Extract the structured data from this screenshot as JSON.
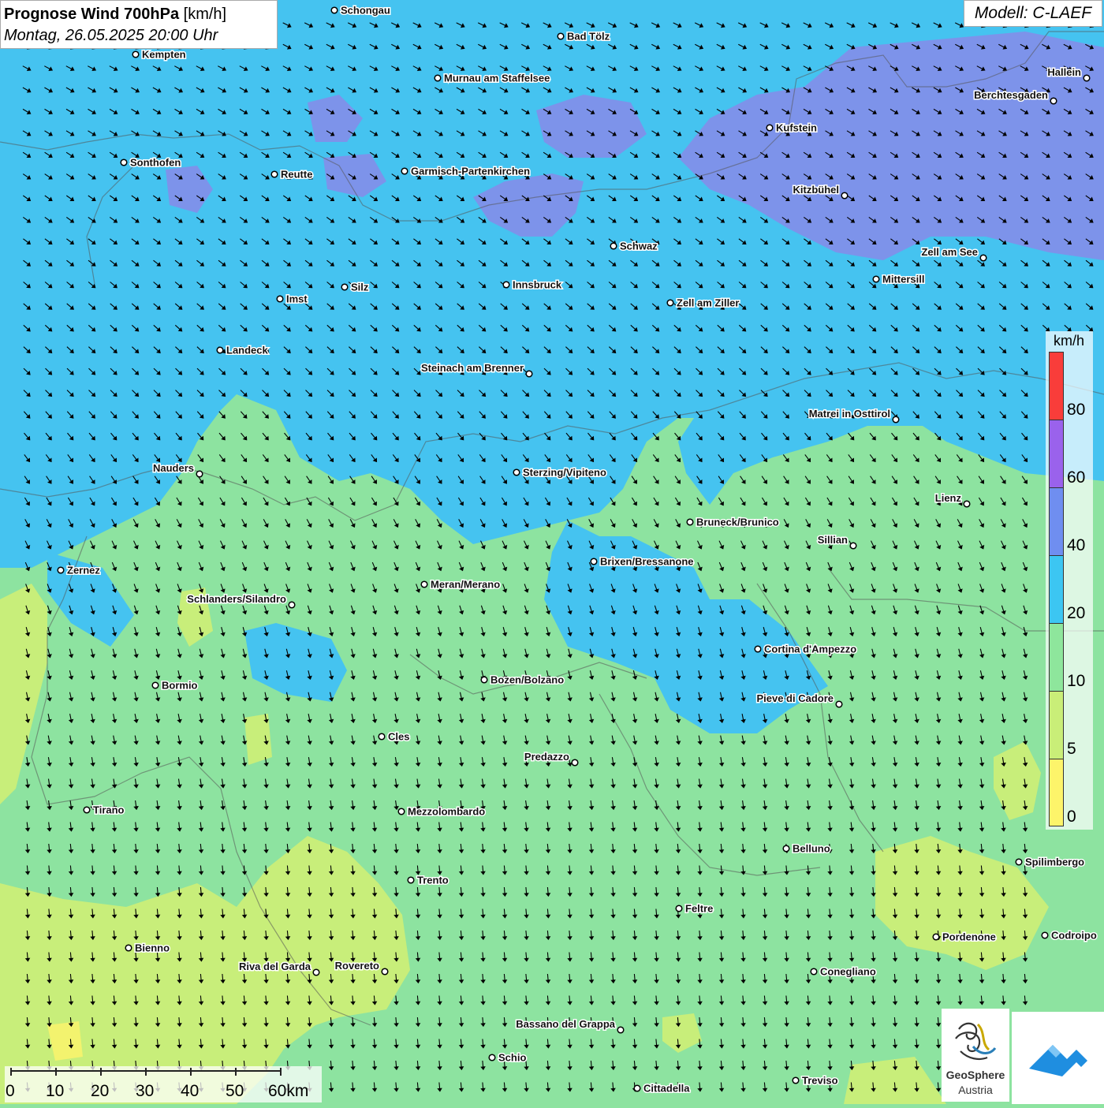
{
  "title": {
    "main": "Prognose Wind 700hPa",
    "unit": "[km/h]",
    "datetime": "Montag, 26.05.2025 20:00 Uhr"
  },
  "model": "Modell: C-LAEF",
  "legend": {
    "unit": "km/h",
    "ticks": [
      "80",
      "60",
      "40",
      "20",
      "10",
      "5",
      "0"
    ],
    "colors": [
      "#f93d3a",
      "#9a62ec",
      "#6f8ef0",
      "#3cc6f2",
      "#8ee69c",
      "#c9ee78",
      "#fdf46a"
    ]
  },
  "scale_bar": {
    "labels": [
      "0",
      "10",
      "20",
      "30",
      "40",
      "50",
      "60km"
    ]
  },
  "logos": {
    "geosphere_line1": "GeoSphere",
    "geosphere_line2": "Austria"
  },
  "cities": [
    {
      "name": "Schongau"
    },
    {
      "name": "Bad Tölz"
    },
    {
      "name": "Kempten"
    },
    {
      "name": "Murnau am Staffelsee"
    },
    {
      "name": "Hallein"
    },
    {
      "name": "Berchtesgaden"
    },
    {
      "name": "Kufstein"
    },
    {
      "name": "Sonthofen"
    },
    {
      "name": "Reutte"
    },
    {
      "name": "Garmisch-Partenkirchen"
    },
    {
      "name": "Kitzbühel"
    },
    {
      "name": "Schwaz"
    },
    {
      "name": "Zell am See"
    },
    {
      "name": "Mittersill"
    },
    {
      "name": "Innsbruck"
    },
    {
      "name": "Silz"
    },
    {
      "name": "Imst"
    },
    {
      "name": "Zell am Ziller"
    },
    {
      "name": "Landeck"
    },
    {
      "name": "Steinach am Brenner"
    },
    {
      "name": "Matrei in Osttirol"
    },
    {
      "name": "Nauders"
    },
    {
      "name": "Sterzing/Vipiteno"
    },
    {
      "name": "Lienz"
    },
    {
      "name": "Bruneck/Brunico"
    },
    {
      "name": "Sillian"
    },
    {
      "name": "Zernez"
    },
    {
      "name": "Brixen/Bressanone"
    },
    {
      "name": "Meran/Merano"
    },
    {
      "name": "Schlanders/Silandro"
    },
    {
      "name": "Cortina d'Ampezzo"
    },
    {
      "name": "Bozen/Bolzano"
    },
    {
      "name": "Bormio"
    },
    {
      "name": "Pieve di Cadore"
    },
    {
      "name": "Cles"
    },
    {
      "name": "Predazzo"
    },
    {
      "name": "Tirano"
    },
    {
      "name": "Mezzolombardo"
    },
    {
      "name": "Belluno"
    },
    {
      "name": "Spilimbergo"
    },
    {
      "name": "Trento"
    },
    {
      "name": "Feltre"
    },
    {
      "name": "Bienno"
    },
    {
      "name": "Pordenone"
    },
    {
      "name": "Codroipo"
    },
    {
      "name": "Riva del Garda"
    },
    {
      "name": "Rovereto"
    },
    {
      "name": "Conegliano"
    },
    {
      "name": "Bassano del Grappa"
    },
    {
      "name": "Schio"
    },
    {
      "name": "Treviso"
    },
    {
      "name": "Cittadella"
    }
  ]
}
